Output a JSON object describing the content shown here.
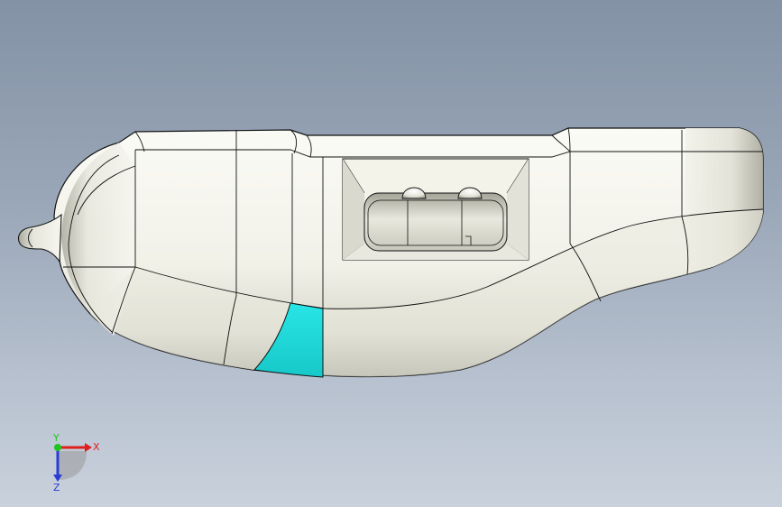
{
  "viewport": {
    "background_top": "#8492a6",
    "background_bottom": "#c9d1dc"
  },
  "model": {
    "body_color": "#f4f4ee",
    "shade_color": "#b8b8ac",
    "edge_color": "#111111",
    "selected_face_color": "#20dede"
  },
  "triad": {
    "x_label": "X",
    "y_label": "Y",
    "z_label": "Z",
    "x_color": "#e01e1e",
    "y_color": "#1fc41f",
    "z_color": "#2a3cd6"
  }
}
